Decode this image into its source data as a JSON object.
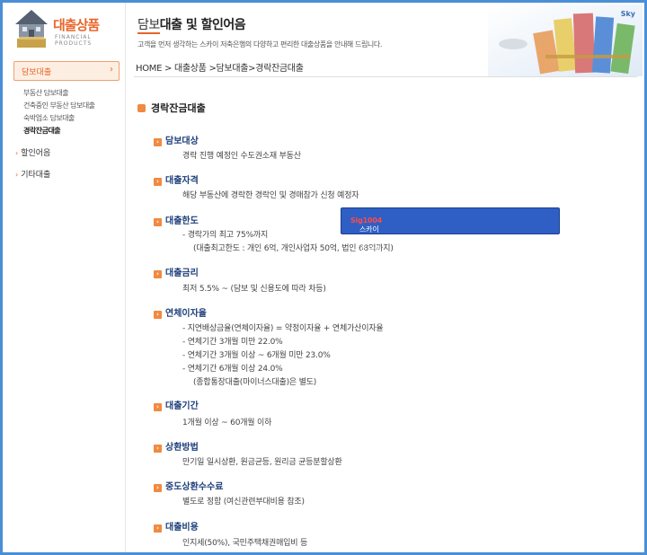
{
  "sidebar": {
    "logo_title": "대출상품",
    "logo_sub_line1": "FINANCIAL",
    "logo_sub_line2": "PRODUCTS",
    "active_label": "담보대출",
    "sub_items": [
      "부동산 담보대출",
      "건축중인 부동산 담보대출",
      "숙박업소 담보대출",
      "경락잔금대출"
    ],
    "menu": [
      "할인어음",
      "기타대출"
    ]
  },
  "header": {
    "title_first": "담보",
    "title_rest": "대출 및 할인어음",
    "desc": "고객을 먼저 생각하는 스카이 저축은행의 다양하고 편리한 대출상품을 안내해 드립니다.",
    "breadcrumb": "HOME > 대출상품 >담보대출>경락잔금대출"
  },
  "banner": {
    "label": "Sky"
  },
  "section_title": "경락잔금대출",
  "promo": {
    "text": "스카이저축은행 대출상품 정보 확인하자!",
    "highlight": "Sig1004"
  },
  "items": [
    {
      "title": "담보대상",
      "lines": [
        "경락 진행 예정인 수도권소재 부동산"
      ]
    },
    {
      "title": "대출자격",
      "lines": [
        "해당 부동산에 경락한 경락인 및 경매참가 신청 예정자"
      ]
    },
    {
      "title": "대출한도",
      "lines": [
        "- 경락가의 최고 75%까지",
        "(대출최고한도 : 개인 6억, 개인사업자 50억, 법인 68억까지)"
      ]
    },
    {
      "title": "대출금리",
      "lines": [
        "최저 5.5% ~ (담보 및 신용도에 따라 차등)"
      ]
    },
    {
      "title": "연체이자율",
      "lines": [
        "- 지연배상금율(연체이자율) = 약정이자율 + 연체가산이자율",
        "- 연체기간 3개월 미만 22.0%",
        "- 연체기간 3개월 이상 ~ 6개월 미만 23.0%",
        "- 연체기간 6개월 이상 24.0%",
        "(종합통장대출(마이너스대출)은 별도)"
      ]
    },
    {
      "title": "대출기간",
      "lines": [
        "1개월 이상 ~ 60개월 이하"
      ]
    },
    {
      "title": "상환방법",
      "lines": [
        "만기일 일시상환, 원금균등, 원리금 균등분할상환"
      ]
    },
    {
      "title": "중도상환수수료",
      "lines": [
        "별도로 정함 (여신관련부대비용 참조)"
      ]
    },
    {
      "title": "대출비용",
      "lines": [
        "인지세(50%), 국민주택채권매입비 등"
      ]
    }
  ]
}
